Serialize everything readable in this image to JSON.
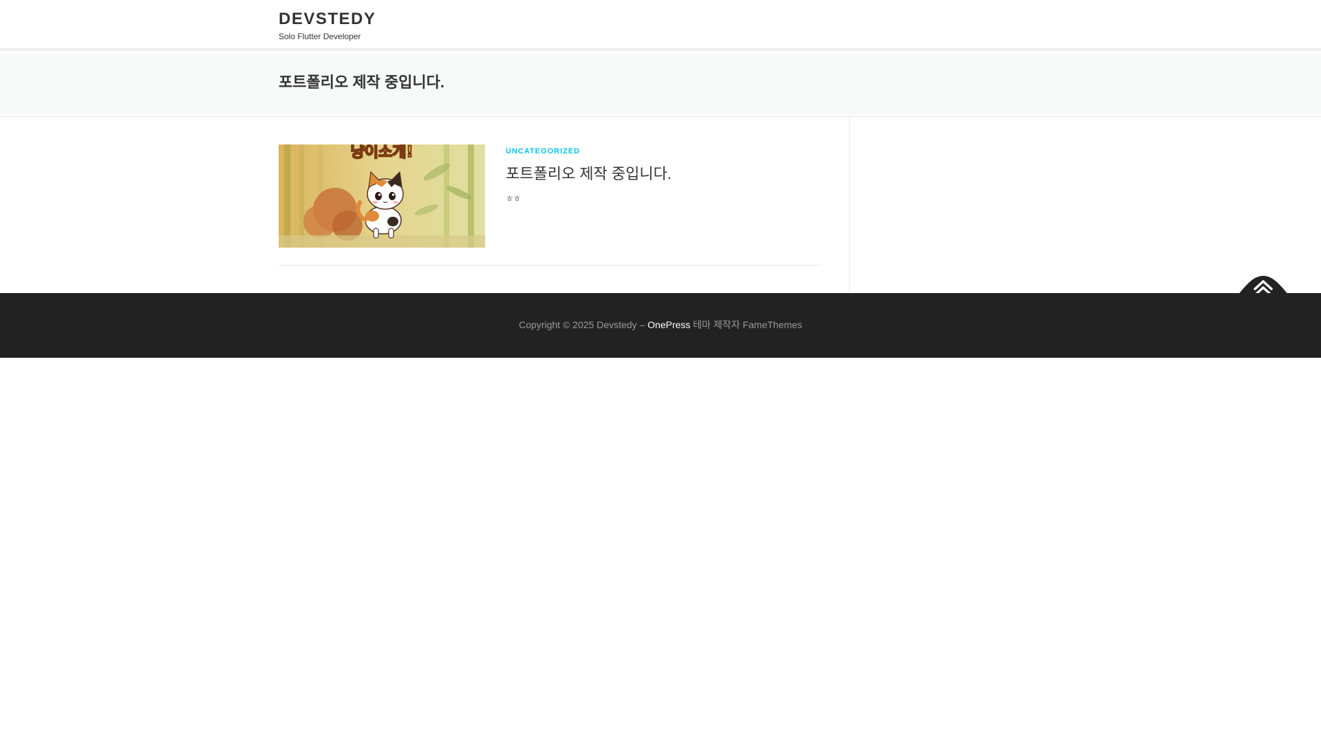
{
  "header": {
    "site_title": "DEVSTEDY",
    "site_description": "Solo Flutter Developer"
  },
  "page": {
    "title": "포트폴리오 제작 중입니다."
  },
  "post": {
    "category": "UNCATEGORIZED",
    "title": "포트폴리오 제작 중입니다.",
    "excerpt": "ㅎㅎ",
    "thumbnail_text": "냥이소개!"
  },
  "footer": {
    "copyright": "Copyright © 2025 Devstedy – ",
    "theme_name": "OnePress",
    "theme_credit": " 테마 제작자 FameThemes"
  },
  "icons": {
    "back_to_top": "double-chevron-up-icon"
  },
  "colors": {
    "accent": "#03c4eb",
    "footer_bg": "#222222",
    "page_header_bg": "#f8f9f9"
  }
}
